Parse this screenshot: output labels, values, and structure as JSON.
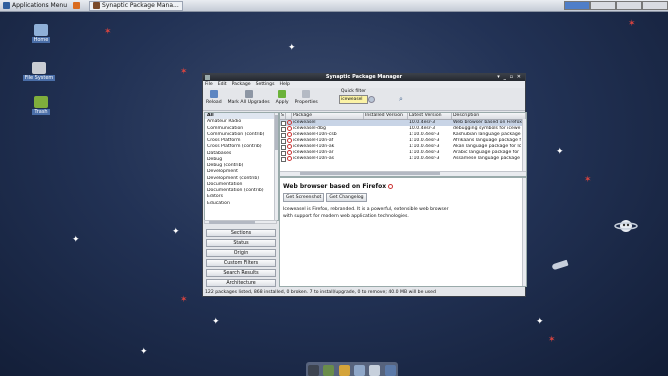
{
  "top_panel": {
    "menu_label": "Applications Menu",
    "task_label": "Synaptic Package Mana..."
  },
  "desktop_icons": [
    {
      "label": "Home",
      "icon": "home-folder-icon"
    },
    {
      "label": "File System",
      "icon": "drive-icon"
    },
    {
      "label": "Trash",
      "icon": "trash-icon"
    }
  ],
  "window": {
    "title": "Synaptic Package Manager",
    "controls": "▾ _ ▫ ✕",
    "menu": [
      "File",
      "Edit",
      "Package",
      "Settings",
      "Help"
    ],
    "toolbar": [
      {
        "label": "Reload",
        "icon": "reload-icon"
      },
      {
        "label": "Mark All Upgrades",
        "icon": "upgrade-icon"
      },
      {
        "label": "Apply",
        "icon": "apply-checkmark-icon"
      },
      {
        "label": "Properties",
        "icon": "properties-icon"
      }
    ],
    "quick_filter": {
      "caption": "Quick filter",
      "value": "iceweasel"
    },
    "sections": [
      "All",
      "Amateur Radio",
      "Communication",
      "Communication (contrib)",
      "Cross Platform",
      "Cross Platform (contrib)",
      "Databases",
      "Debug",
      "Debug (contrib)",
      "Development",
      "Development (contrib)",
      "Documentation",
      "Documentation (contrib)",
      "Editors",
      "Education"
    ],
    "filter_buttons": [
      "Sections",
      "Status",
      "Origin",
      "Custom Filters",
      "Search Results",
      "Architecture"
    ],
    "columns": [
      "S",
      "",
      "Package",
      "Installed Version",
      "Latest Version",
      "Description"
    ],
    "packages": [
      {
        "name": "iceweasel",
        "installed": "",
        "latest": "10.0.4esr-3",
        "desc": "Web browser based on Firefox"
      },
      {
        "name": "iceweasel-dbg",
        "installed": "",
        "latest": "10.0.4esr-3",
        "desc": "debugging symbols for icewe"
      },
      {
        "name": "iceweasel-l10n-csb",
        "installed": "",
        "latest": "1:10.0.4esr-3",
        "desc": "Kashubian language package"
      },
      {
        "name": "iceweasel-l10n-af",
        "installed": "",
        "latest": "1:10.0.4esr-3",
        "desc": "Afrikaans language package f"
      },
      {
        "name": "iceweasel-l10n-ak",
        "installed": "",
        "latest": "1:10.0.4esr-3",
        "desc": "Akan language package for Ic"
      },
      {
        "name": "iceweasel-l10n-ar",
        "installed": "",
        "latest": "1:10.0.4esr-3",
        "desc": "Arabic language package for"
      },
      {
        "name": "iceweasel-l10n-as",
        "installed": "",
        "latest": "1:10.0.4esr-3",
        "desc": "Assamese language package"
      }
    ],
    "details": {
      "title": "Web browser based on Firefox",
      "buttons": [
        "Get Screenshot",
        "Get Changelog"
      ],
      "text": "Iceweasel is Firefox, rebranded. It is a powerful, extensible web browser with support for modern web application technologies."
    },
    "status": "122 packages listed, 868 installed, 0 broken. 7 to install/upgrade, 0 to remove; 40.0 MB will be used"
  },
  "dock_icons": [
    "terminal-icon",
    "file-manager-icon",
    "browser-icon",
    "settings-icon",
    "search-icon",
    "folder-icon"
  ]
}
